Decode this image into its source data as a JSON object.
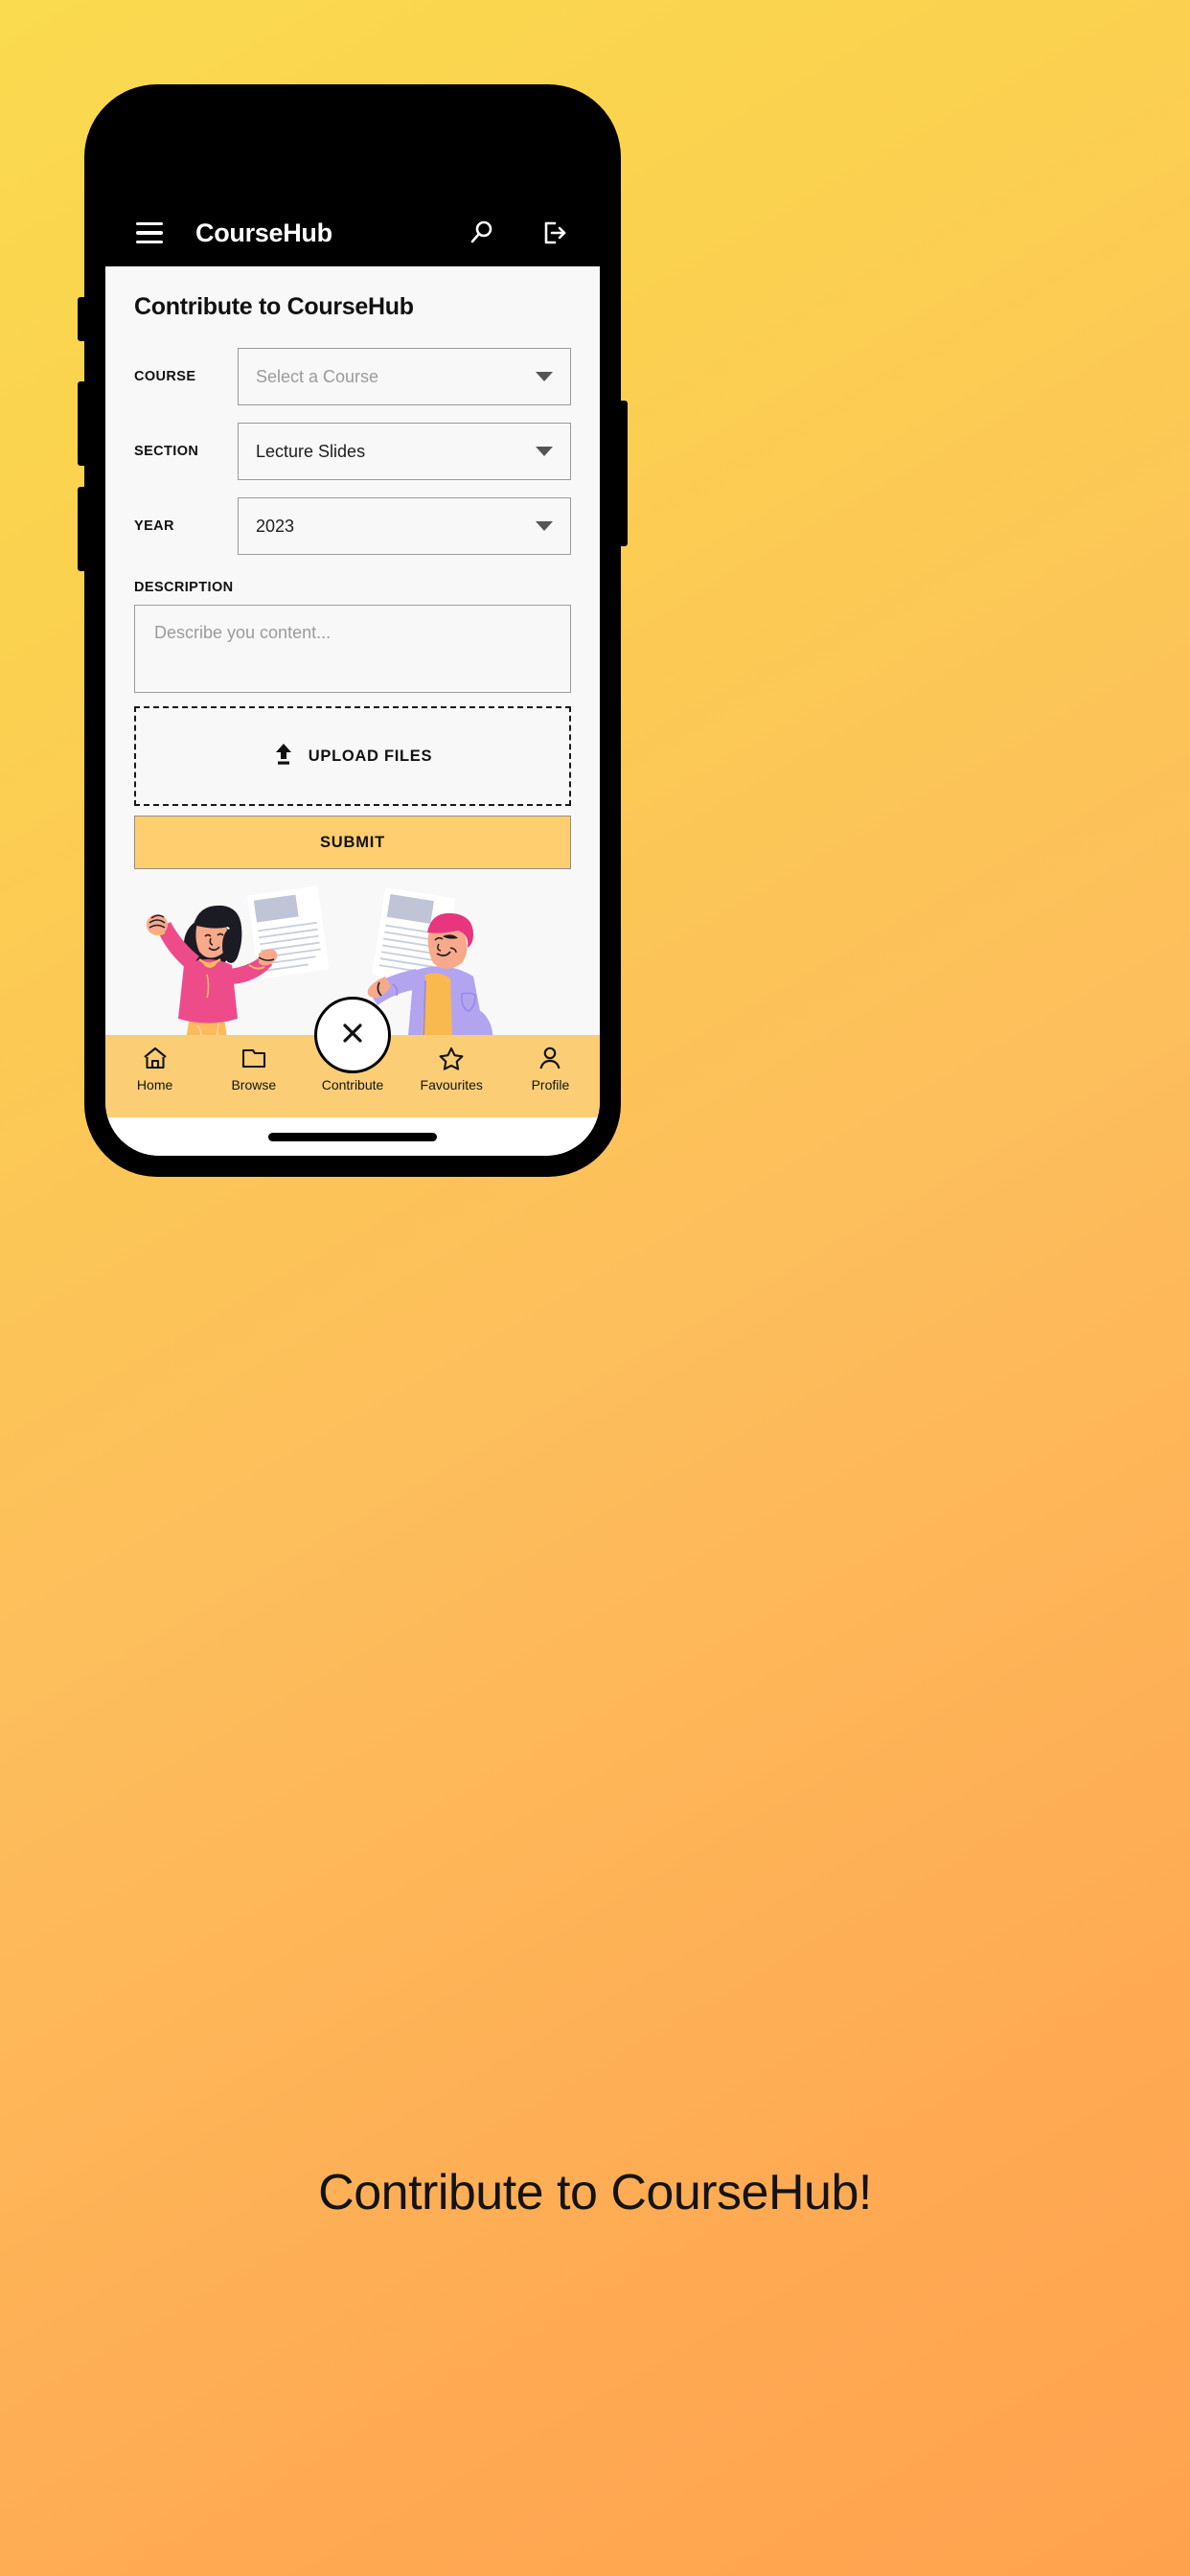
{
  "background": {
    "gradient_from": "#FADA4F",
    "gradient_to": "#FFA852"
  },
  "app": {
    "title": "CourseHub",
    "menu_icon": "hamburger-menu-icon",
    "search_icon": "search-icon",
    "logout_icon": "logout-icon"
  },
  "page": {
    "title": "Contribute to CourseHub"
  },
  "form": {
    "fields": [
      {
        "label": "COURSE",
        "value": "Select a Course",
        "is_placeholder": true
      },
      {
        "label": "SECTION",
        "value": "Lecture Slides",
        "is_placeholder": false
      },
      {
        "label": "YEAR",
        "value": "2023",
        "is_placeholder": false
      }
    ],
    "description": {
      "label": "DESCRIPTION",
      "placeholder": "Describe you content...",
      "value": ""
    },
    "upload": {
      "label": "UPLOAD FILES",
      "icon": "upload-arrow-icon"
    },
    "submit": {
      "label": "SUBMIT",
      "color": "#FFCE6F"
    }
  },
  "illustration": {
    "alt": "two-people-holding-documents",
    "colors": {
      "pink_sweater": "#EE4B8B",
      "orange_skirt": "#FBBA5C",
      "purple_jacket": "#B3A4F0",
      "orange_shirt": "#F9B94E",
      "pink_hair": "#E8357E",
      "skin": "#F7A98A",
      "hair_dark": "#1B1B24",
      "paper": "#FFFFFF",
      "paper_header": "#BFC4D6"
    }
  },
  "bottom_nav": {
    "background": "#FBCE76",
    "items": [
      {
        "label": "Home",
        "icon": "home-icon"
      },
      {
        "label": "Browse",
        "icon": "folder-icon"
      },
      {
        "label": "Contribute",
        "icon": "close-x-icon",
        "active": true
      },
      {
        "label": "Favourites",
        "icon": "star-icon"
      },
      {
        "label": "Profile",
        "icon": "person-icon"
      }
    ]
  },
  "caption": {
    "text": "Contribute to CourseHub!"
  }
}
